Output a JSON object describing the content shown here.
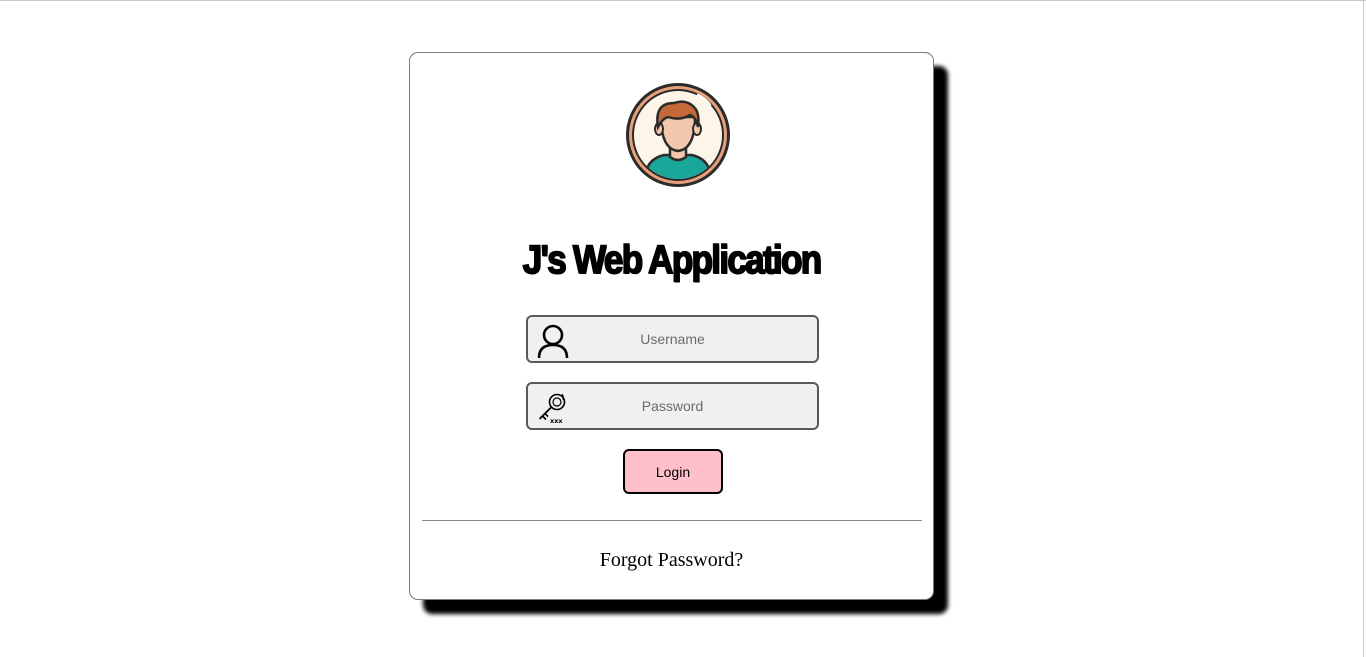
{
  "app": {
    "title": "J's Web Application"
  },
  "avatar": {
    "icon": "user-avatar-icon",
    "ring_color": "#e8a07a",
    "bg_color": "#fdf6e8",
    "shirt_color": "#1aa79a",
    "hair_color": "#c5693a"
  },
  "form": {
    "username": {
      "placeholder": "Username",
      "value": "",
      "icon": "user-icon"
    },
    "password": {
      "placeholder": "Password",
      "value": "",
      "icon": "key-icon"
    },
    "login_label": "Login",
    "login_color": "#ffc0cb"
  },
  "footer": {
    "forgot_label": "Forgot Password?"
  }
}
